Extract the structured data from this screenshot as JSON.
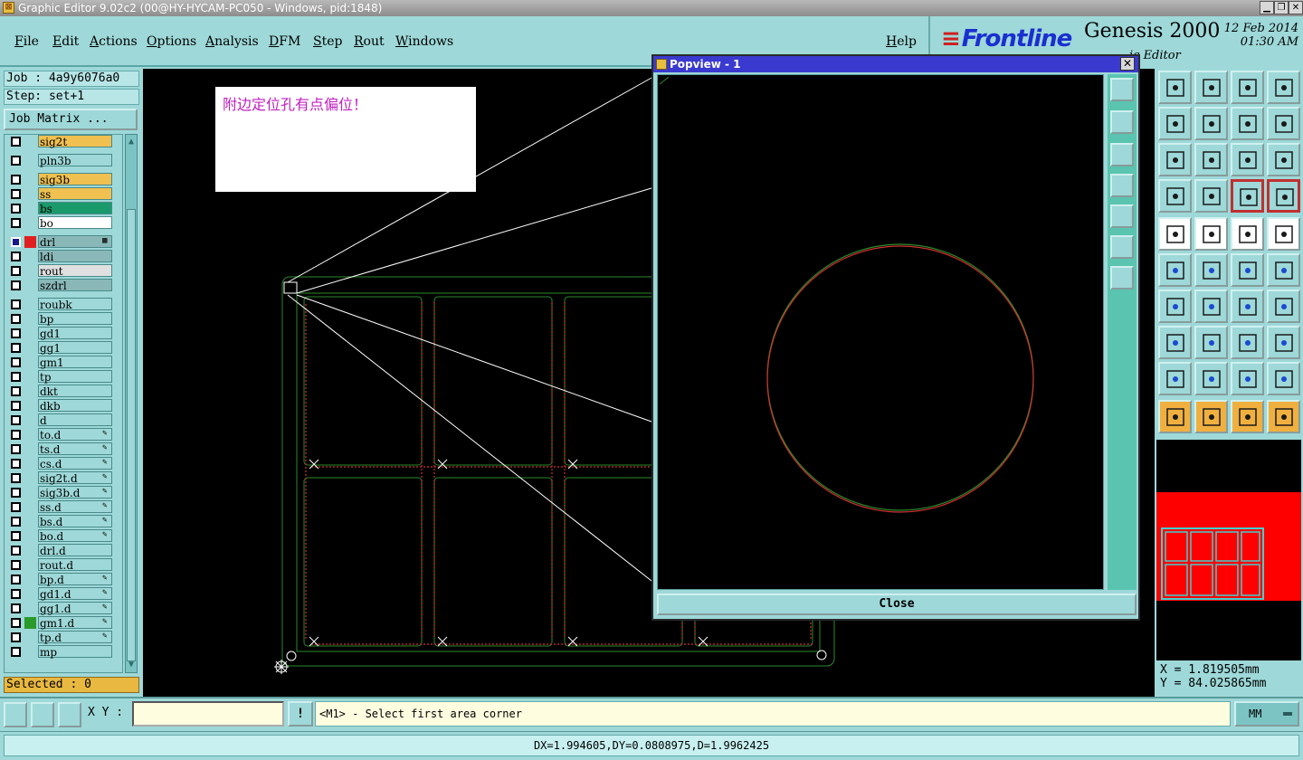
{
  "window": {
    "title": "Graphic Editor 9.02c2 (00@HY-HYCAM-PC050 - Windows, pid:1848)"
  },
  "menu": {
    "file": "File",
    "edit": "Edit",
    "actions": "Actions",
    "options": "Options",
    "analysis": "Analysis",
    "dfm": "DFM",
    "step": "Step",
    "rout": "Rout",
    "windows": "Windows",
    "help": "Help"
  },
  "brand": {
    "logo": "Frontline",
    "product": "Genesis 2000",
    "date": "12 Feb 2014",
    "time": "01:30 AM",
    "subtitle": "ic Editor"
  },
  "job": {
    "job_text": "Job : 4a9y6076a0",
    "step_text": "Step: set+1",
    "matrix_button": "Job Matrix ..."
  },
  "layers": [
    {
      "name": "sig2t",
      "color": "#f0c050"
    },
    {
      "name": "pln3b",
      "color": "#9ed8d8"
    },
    {
      "name": "sig3b",
      "color": "#f0c050"
    },
    {
      "name": "ss",
      "color": "#f0c050"
    },
    {
      "name": "bs",
      "color": "#1a9a6a"
    },
    {
      "name": "bo",
      "color": "#ffffff"
    },
    {
      "name": "drl",
      "color": "#8ab8b8",
      "swatch": "#e02020",
      "active": true,
      "tag": "▦"
    },
    {
      "name": "ldi",
      "color": "#8ab8b8"
    },
    {
      "name": "rout",
      "color": "#e0e0e0"
    },
    {
      "name": "szdrl",
      "color": "#8ab8b8"
    },
    {
      "name": "roubk",
      "color": "#9ed8d8"
    },
    {
      "name": "bp",
      "color": "#9ed8d8"
    },
    {
      "name": "gd1",
      "color": "#9ed8d8"
    },
    {
      "name": "gg1",
      "color": "#9ed8d8"
    },
    {
      "name": "gm1",
      "color": "#9ed8d8"
    },
    {
      "name": "tp",
      "color": "#9ed8d8"
    },
    {
      "name": "dkt",
      "color": "#9ed8d8"
    },
    {
      "name": "dkb",
      "color": "#9ed8d8"
    },
    {
      "name": "d",
      "color": "#9ed8d8"
    },
    {
      "name": "to.d",
      "color": "#9ed8d8",
      "tag": "✎"
    },
    {
      "name": "ts.d",
      "color": "#9ed8d8",
      "tag": "✎"
    },
    {
      "name": "cs.d",
      "color": "#9ed8d8",
      "tag": "✎"
    },
    {
      "name": "sig2t.d",
      "color": "#9ed8d8",
      "tag": "✎"
    },
    {
      "name": "sig3b.d",
      "color": "#9ed8d8",
      "tag": "✎"
    },
    {
      "name": "ss.d",
      "color": "#9ed8d8",
      "tag": "✎"
    },
    {
      "name": "bs.d",
      "color": "#9ed8d8",
      "tag": "✎"
    },
    {
      "name": "bo.d",
      "color": "#9ed8d8",
      "tag": "✎"
    },
    {
      "name": "drl.d",
      "color": "#9ed8d8"
    },
    {
      "name": "rout.d",
      "color": "#9ed8d8"
    },
    {
      "name": "bp.d",
      "color": "#9ed8d8",
      "tag": "✎"
    },
    {
      "name": "gd1.d",
      "color": "#9ed8d8",
      "tag": "✎"
    },
    {
      "name": "gg1.d",
      "color": "#9ed8d8",
      "tag": "✎"
    },
    {
      "name": "gm1.d",
      "color": "#9ed8d8",
      "swatch": "#2a9a2a",
      "tag": "✎"
    },
    {
      "name": "tp.d",
      "color": "#9ed8d8",
      "tag": "✎"
    },
    {
      "name": "mp",
      "color": "#9ed8d8"
    }
  ],
  "selected_text": "Selected : 0",
  "note_text": "附边定位孔有点偏位！",
  "popview": {
    "title": "Popview - 1",
    "close_label": "Close",
    "close_x": "✕"
  },
  "coords": {
    "x_text": "X = 1.819505mm",
    "y_text": "Y = 84.025865mm"
  },
  "bottom": {
    "xy_label": "X Y :",
    "xy_value": "",
    "excl": "!",
    "prompt": "<M1> - Select first area corner",
    "units": "MM"
  },
  "status": "DX=1.994605,DY=0.0808975,D=1.9962425",
  "colors": {
    "background": "#9ed8d8",
    "canvas": "#000000",
    "board_outline": "#2a8a2a",
    "drill_marks": "#d03030",
    "highlight": "#f0b040"
  }
}
